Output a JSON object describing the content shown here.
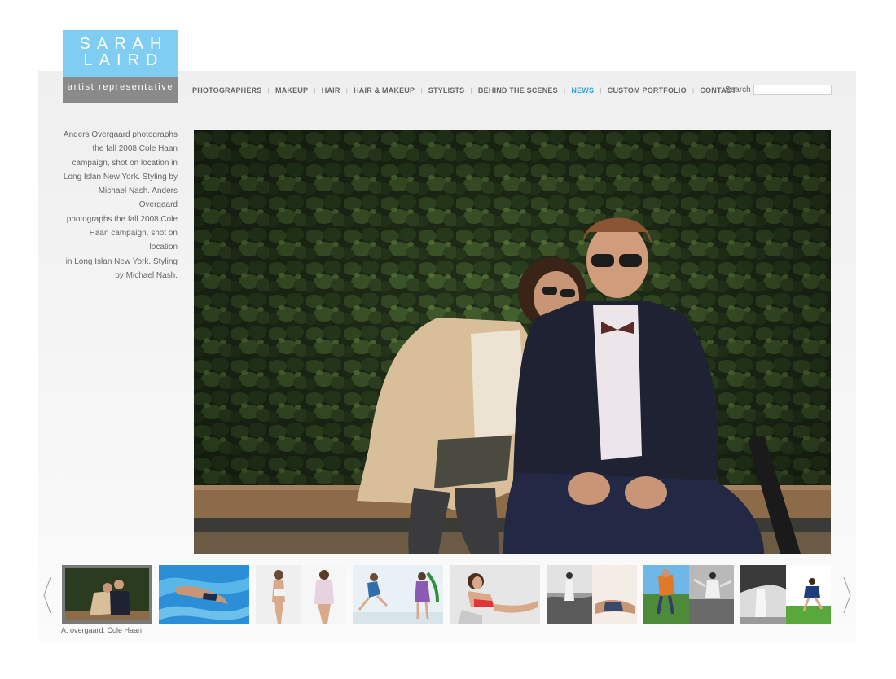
{
  "logo": {
    "line1": "SARAH",
    "line2": "LAIRD",
    "tagline": "artist representative"
  },
  "nav": {
    "items": [
      {
        "label": "PHOTOGRAPHERS",
        "active": false
      },
      {
        "label": "MAKEUP",
        "active": false
      },
      {
        "label": "HAIR",
        "active": false
      },
      {
        "label": "HAIR & MAKEUP",
        "active": false
      },
      {
        "label": "STYLISTS",
        "active": false
      },
      {
        "label": "BEHIND THE SCENES",
        "active": false
      },
      {
        "label": "NEWS",
        "active": true
      },
      {
        "label": "CUSTOM PORTFOLIO",
        "active": false
      },
      {
        "label": "CONTACT",
        "active": false
      }
    ]
  },
  "search": {
    "label": "Search",
    "value": "",
    "placeholder": ""
  },
  "feature": {
    "caption_lines": [
      "Anders Overgaard photographs",
      "the fall 2008 Cole Haan",
      "campaign, shot on location in",
      "Long Islan New York. Styling by",
      "Michael Nash. Anders Overgaard",
      "photographs the fall 2008 Cole",
      "Haan campaign, shot on location",
      "in Long Islan New York. Styling",
      "by Michael Nash."
    ]
  },
  "gallery": {
    "selected_index": 0,
    "selected_caption": "A. overgaard: Cole Haan",
    "thumb_count": 8
  },
  "colors": {
    "brand_blue": "#7fcdf2",
    "active_nav": "#2aa3dc",
    "tagline_gray": "#8a8a8a"
  }
}
